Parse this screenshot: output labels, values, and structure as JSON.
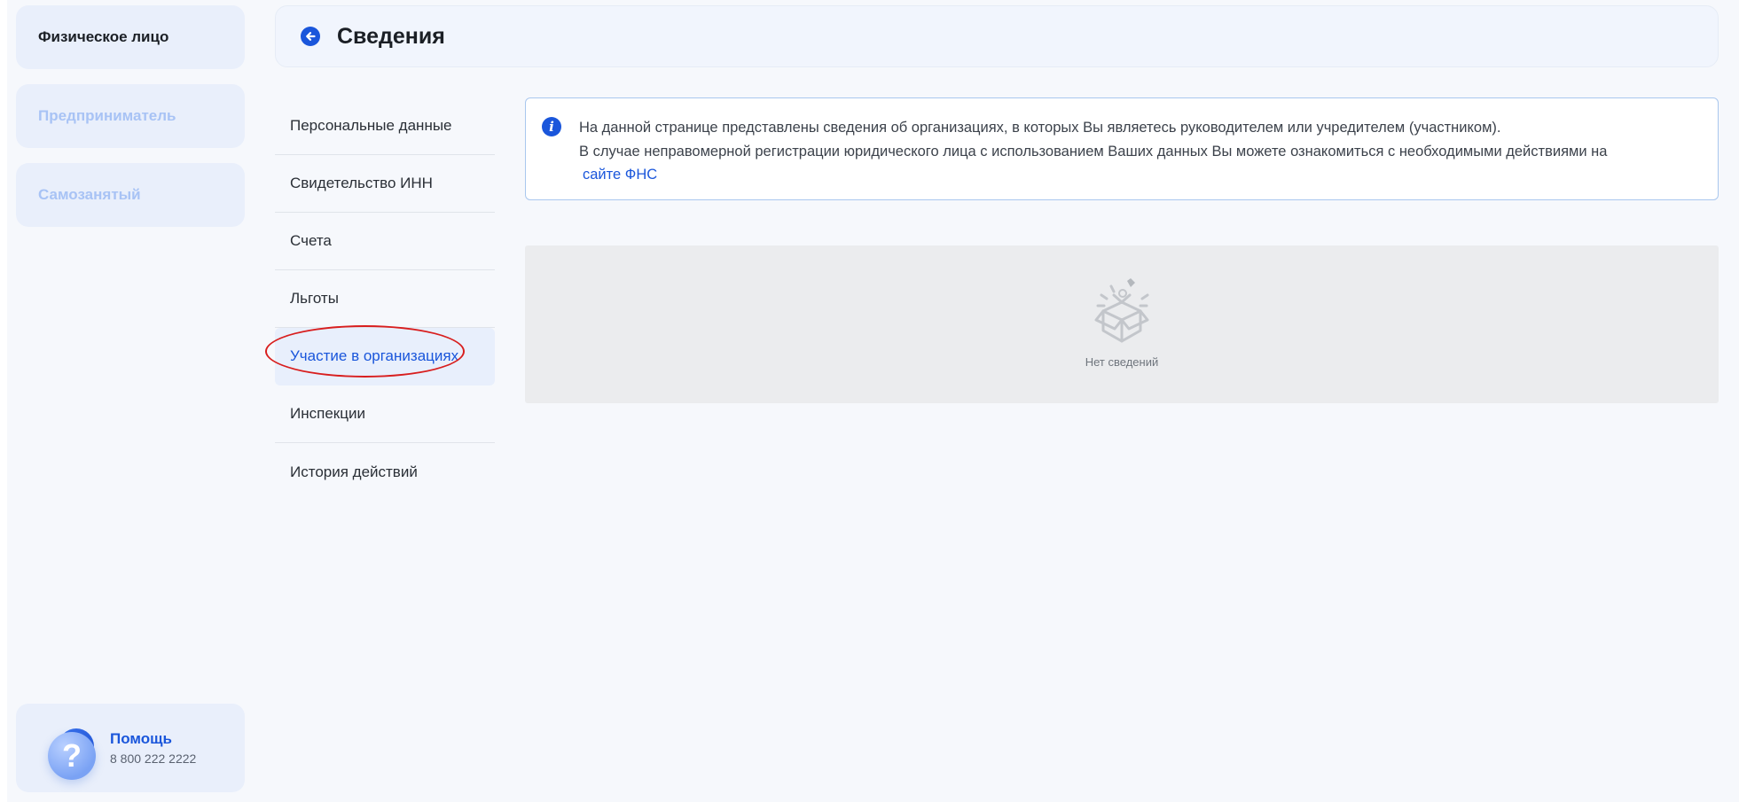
{
  "sidebar": {
    "roles": [
      {
        "label": "Физическое лицо",
        "active": true
      },
      {
        "label": "Предприниматель",
        "active": false
      },
      {
        "label": "Самозанятый",
        "active": false
      }
    ],
    "help": {
      "title": "Помощь",
      "phone": "8 800 222 2222"
    }
  },
  "header": {
    "title": "Сведения",
    "back_icon": "arrow-left-circle-icon"
  },
  "submenu": {
    "items": [
      {
        "label": "Персональные данные"
      },
      {
        "label": "Свидетельство ИНН"
      },
      {
        "label": "Счета"
      },
      {
        "label": "Льготы"
      },
      {
        "label": "Участие в организациях",
        "selected": true
      },
      {
        "label": "Инспекции"
      },
      {
        "label": "История действий"
      }
    ]
  },
  "info": {
    "icon": "info-icon",
    "line1": "На данной странице представлены сведения об организациях, в которых Вы являетесь руководителем или учредителем (участником).",
    "line2": "В случае неправомерной регистрации юридического лица с использованием Ваших данных Вы можете ознакомиться с необходимыми действиями на",
    "link": "сайте ФНС"
  },
  "empty_state": {
    "icon": "empty-box-icon",
    "text": "Нет сведений"
  },
  "colors": {
    "accent": "#1a56db",
    "inactive_role": "#a8c3f5",
    "highlight": "#d81e1e"
  }
}
